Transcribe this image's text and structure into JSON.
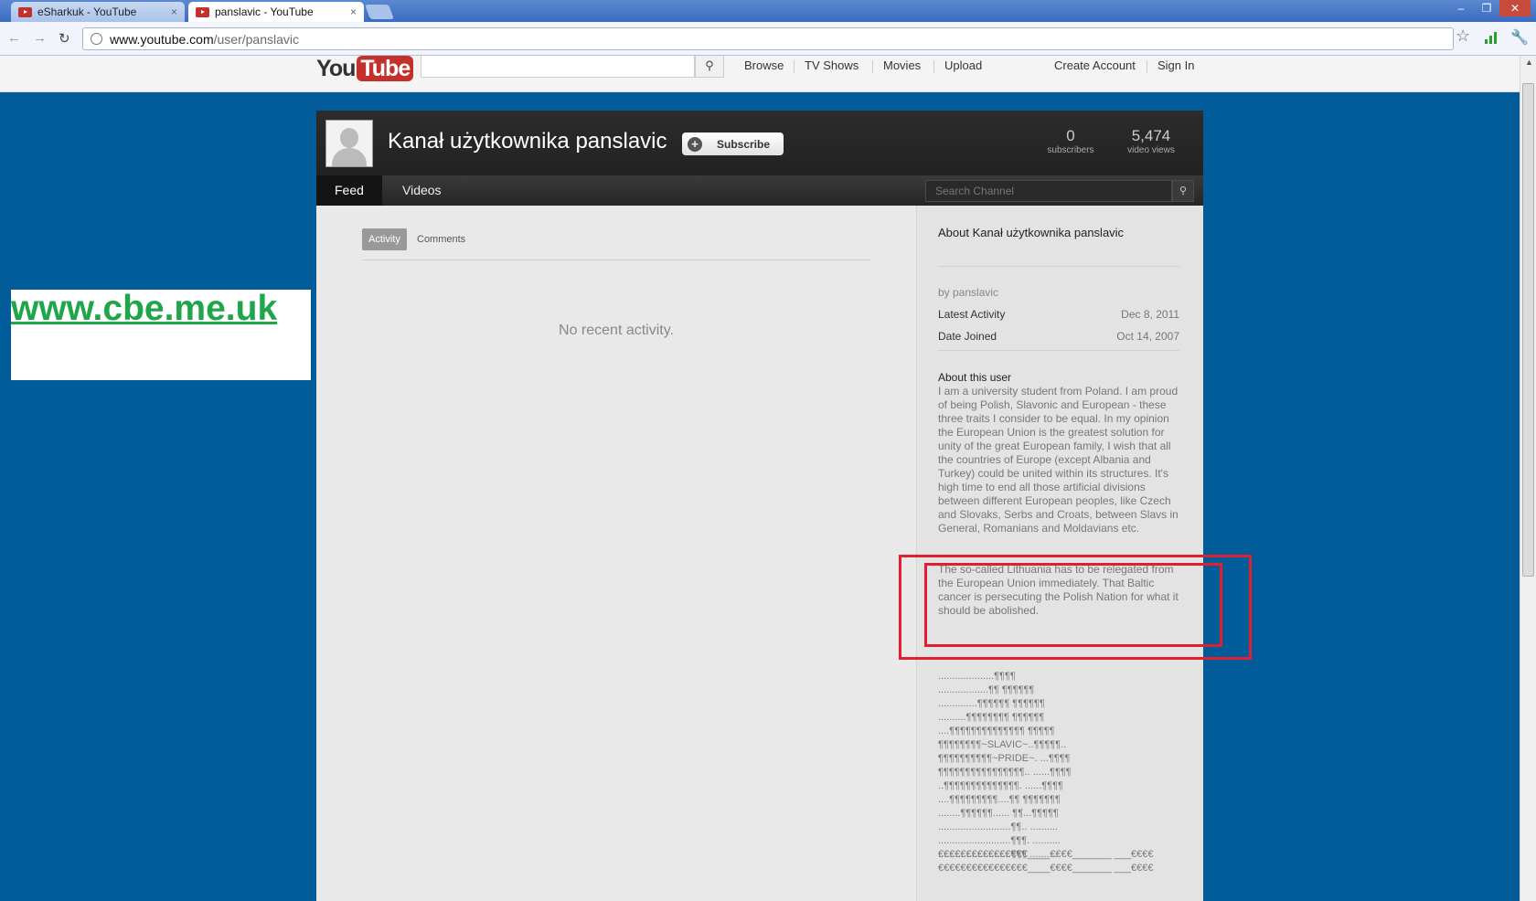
{
  "browser": {
    "tabs": [
      {
        "title": "eSharkuk - YouTube",
        "close": "×"
      },
      {
        "title": "panslavic - YouTube",
        "close": "×"
      }
    ],
    "window_controls": [
      "–",
      "❐",
      "✕"
    ],
    "nav": {
      "back": "←",
      "forward": "→",
      "reload": "↻"
    },
    "url_host": "www.youtube.com",
    "url_path": "/user/panslavic"
  },
  "youtube": {
    "logo_you": "You",
    "logo_tube": "Tube",
    "search_icon": "search-icon",
    "nav": [
      "Browse",
      "TV Shows",
      "Movies",
      "Upload"
    ],
    "create_account": "Create Account",
    "sign_in": "Sign In"
  },
  "ad": {
    "text": "www.cbe.me.uk",
    "color": "#1fa64a"
  },
  "channel": {
    "title": "Kanał użytkownika panslavic",
    "subscribe": "Subscribe",
    "stats": [
      {
        "value": "0",
        "label": "subscribers"
      },
      {
        "value": "5,474",
        "label": "video views"
      }
    ],
    "tabs": [
      "Feed",
      "Videos"
    ],
    "search_placeholder": "Search Channel",
    "feed_tabs": [
      "Activity",
      "Comments"
    ],
    "no_activity": "No recent activity."
  },
  "about": {
    "title": "About Kanał użytkownika panslavic",
    "by": "by panslavic",
    "latest_activity_label": "Latest Activity",
    "latest_activity_value": "Dec 8, 2011",
    "date_joined_label": "Date Joined",
    "date_joined_value": "Oct 14, 2007",
    "about_user_label": "About this user",
    "bio": "I am a university student from Poland. I am proud of being Polish, Slavonic and European - these three traits I consider to be equal. In my opinion the European Union is the greatest solution for unity of the great European family, I wish that all the countries of Europe (except Albania and Turkey) could be united within its structures. It's high time to end all those artificial divisions between different European peoples, like Czech and Slovaks, Serbs and Croats, between Slavs in General, Romanians and Moldavians etc.",
    "bio_highlight": "The so-called Lithuania has to be relegated from the European Union immediately. That Baltic cancer is persecuting the Polish Nation for what it should be abolished.",
    "ascii_art": "....................¶¶¶¶\n..................¶¶ ¶¶¶¶¶¶\n..............¶¶¶¶¶¶ ¶¶¶¶¶¶\n..........¶¶¶¶¶¶¶¶ ¶¶¶¶¶¶\n....¶¶¶¶¶¶¶¶¶¶¶¶¶¶ ¶¶¶¶¶\n¶¶¶¶¶¶¶¶~SLAVIC~..¶¶¶¶¶..\n¶¶¶¶¶¶¶¶¶¶~PRIDE~. ...¶¶¶¶\n¶¶¶¶¶¶¶¶¶¶¶¶¶¶¶¶.. ......¶¶¶¶\n..¶¶¶¶¶¶¶¶¶¶¶¶¶¶. ......¶¶¶¶\n....¶¶¶¶¶¶¶¶¶....¶¶ ¶¶¶¶¶¶¶\n........¶¶¶¶¶¶...... ¶¶...¶¶¶¶¶\n..........................¶¶.. ..........\n..........................¶¶¶. ..........\n..........................¶¶¶ ..........",
    "ascii_art2": "€€€€€€€€€€€€€€€€____€€€€_______ ___€€€€\n€€€€€€€€€€€€€€€€____€€€€_______ ___€€€€"
  },
  "annotation": {
    "color": "#e0202e"
  }
}
